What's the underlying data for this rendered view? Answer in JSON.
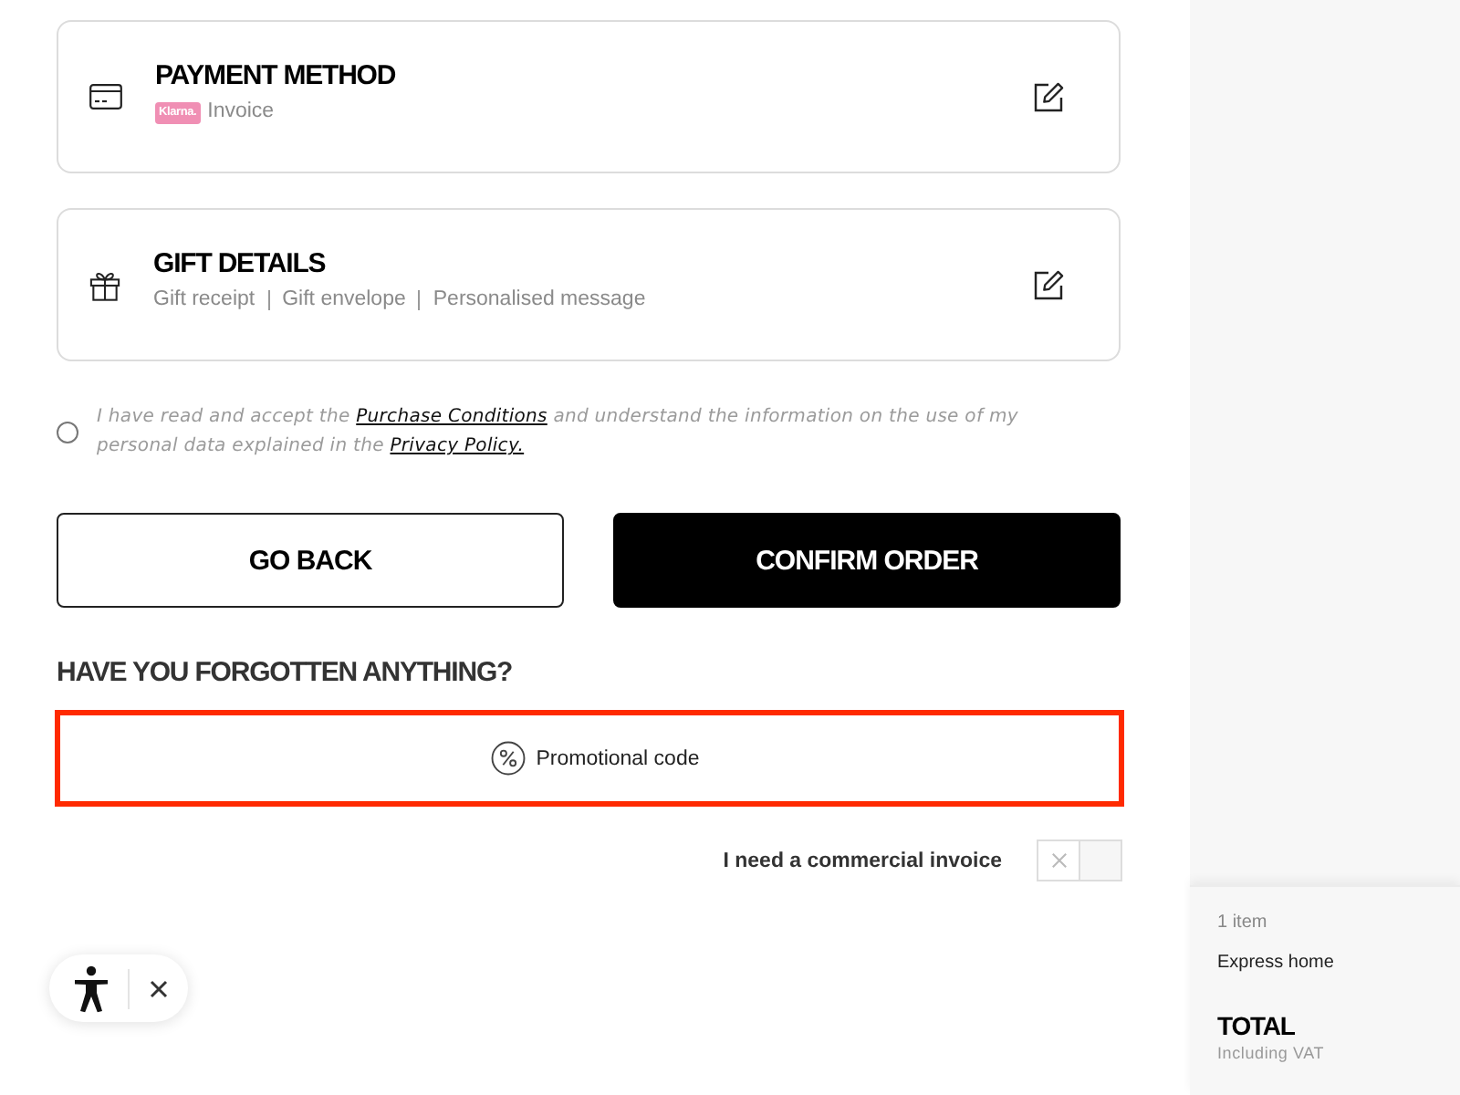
{
  "sections": [
    {
      "kind": "payment",
      "title": "PAYMENT METHOD",
      "badge": "Klarna.",
      "detail": "Invoice"
    },
    {
      "kind": "gift",
      "title": "GIFT DETAILS",
      "details": [
        "Gift receipt",
        "Gift envelope",
        "Personalised message"
      ]
    }
  ],
  "terms": {
    "checked": false,
    "parts": [
      {
        "kind": "text",
        "text": "I have read and accept the "
      },
      {
        "kind": "link",
        "text": "Purchase Conditions"
      },
      {
        "kind": "text",
        "text": " and understand the information on the use of my personal data explained in the "
      },
      {
        "kind": "link",
        "text": "Privacy Policy."
      }
    ]
  },
  "buttons": [
    {
      "kind": "secondary",
      "label": "GO BACK"
    },
    {
      "kind": "primary",
      "label": "CONFIRM ORDER"
    }
  ],
  "extras": {
    "heading": "HAVE YOU FORGOTTEN ANYTHING?",
    "promo_code": {
      "label": "Promotional code",
      "highlighted": true
    },
    "commercial_invoice": {
      "label": "I need a commercial invoice",
      "on": false
    }
  },
  "summary": {
    "items": "1 item",
    "shipping": "Express home",
    "total_label": "TOTAL",
    "total_note": "Including VAT"
  }
}
